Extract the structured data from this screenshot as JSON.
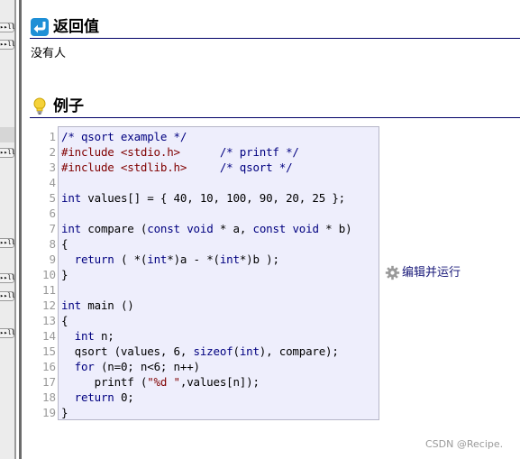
{
  "sidebar": {
    "buttons": [
      {
        "label": "▸▸ll"
      },
      {
        "label": "▸▸ll"
      },
      {
        "label": "▸▸ll"
      },
      {
        "label": "▸▸ll"
      },
      {
        "label": "▸▸ll"
      },
      {
        "label": "▸▸ll"
      },
      {
        "label": "▸▸ll"
      },
      {
        "label": "▸▸ll"
      }
    ]
  },
  "return_section": {
    "title": "返回值",
    "text": "没有人",
    "icon": "return-arrow-icon"
  },
  "example_section": {
    "title": "例子",
    "icon": "lightbulb-icon"
  },
  "code": {
    "line_numbers": [
      "1",
      "2",
      "3",
      "4",
      "5",
      "6",
      "7",
      "8",
      "9",
      "10",
      "11",
      "12",
      "13",
      "14",
      "15",
      "16",
      "17",
      "18",
      "19"
    ],
    "lines": [
      "/* qsort example */",
      "#include <stdio.h>      /* printf */",
      "#include <stdlib.h>     /* qsort */",
      "",
      "int values[] = { 40, 10, 100, 90, 20, 25 };",
      "",
      "int compare (const void * a, const void * b)",
      "{",
      "  return ( *(int*)a - *(int*)b );",
      "}",
      "",
      "int main ()",
      "{",
      "  int n;",
      "  qsort (values, 6, sizeof(int), compare);",
      "  for (n=0; n<6; n++)",
      "     printf (\"%d \",values[n]);",
      "  return 0;",
      "}"
    ]
  },
  "run_link": {
    "label": "编辑并运行",
    "icon": "gear-icon"
  },
  "watermark": "CSDN @Recipe.",
  "colors": {
    "accent_blue": "#1e8fd6",
    "rule": "#000066",
    "code_bg": "#eeeefc",
    "comment": "#000080",
    "preprocessor": "#800000"
  }
}
